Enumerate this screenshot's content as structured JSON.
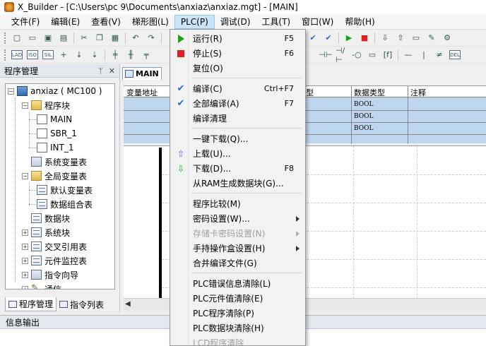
{
  "window": {
    "title": "X_Builder - [C:\\Users\\pc        9\\Documents\\anxiaz\\anxiaz.mgt] - [MAIN]"
  },
  "menubar": [
    {
      "label": "文件(F)"
    },
    {
      "label": "编辑(E)"
    },
    {
      "label": "查看(V)"
    },
    {
      "label": "梯形图(L)"
    },
    {
      "label": "PLC(P)"
    },
    {
      "label": "调试(D)"
    },
    {
      "label": "工具(T)"
    },
    {
      "label": "窗口(W)"
    },
    {
      "label": "帮助(H)"
    }
  ],
  "toolbar2": {
    "box_a": "LAD",
    "box_b": "ISO",
    "box_c": "SIL",
    "del": "DEL"
  },
  "left_panel": {
    "title": "程序管理",
    "pin": "ᛘ",
    "close": "✕",
    "tree": {
      "root": "anxiaz ( MC100 )",
      "program_block": "程序块",
      "main": "MAIN",
      "sbr": "SBR_1",
      "int": "INT_1",
      "system_var_table": "系统变量表",
      "global_var_table": "全局变量表",
      "default_var_table": "默认变量表",
      "data_group_table": "数据组合表",
      "data_block": "数据块",
      "system_block": "系统块",
      "cross_ref_table": "交叉引用表",
      "element_monitor_table": "元件监控表",
      "instruction_wizard": "指令向导",
      "communication": "通信"
    },
    "tabs": {
      "program_mgmt": "程序管理",
      "instruction_list": "指令列表"
    }
  },
  "editor": {
    "tab": "MAIN",
    "var_table": {
      "headers": {
        "var_addr": "变量地址",
        "type_partial": "型",
        "data_type": "数据类型",
        "comment": "注释"
      },
      "rows": [
        "BOOL",
        "BOOL",
        "BOOL"
      ]
    }
  },
  "output": {
    "title": "信息输出"
  },
  "watermark": {
    "text": "安下载",
    "url": "anxz.com"
  },
  "plc_menu": {
    "run": {
      "label": "运行(R)",
      "shortcut": "F5"
    },
    "stop": {
      "label": "停止(S)",
      "shortcut": "F6"
    },
    "reset": {
      "label": "复位(O)"
    },
    "compile": {
      "label": "编译(C)",
      "shortcut": "Ctrl+F7"
    },
    "compile_all": {
      "label": "全部编译(A)",
      "shortcut": "F7"
    },
    "compile_clean": {
      "label": "编译清理"
    },
    "one_key_download": {
      "label": "一键下载(Q)..."
    },
    "upload": {
      "label": "上载(U)..."
    },
    "download": {
      "label": "下载(D)...",
      "shortcut": "F8"
    },
    "ram_generate": {
      "label": "从RAM生成数据块(G)..."
    },
    "program_compare": {
      "label": "程序比较(M)"
    },
    "password_settings": {
      "label": "密码设置(W)..."
    },
    "card_password": {
      "label": "存储卡密码设置(N)"
    },
    "handheld_settings": {
      "label": "手持操作盒设置(H)"
    },
    "merge_compile": {
      "label": "合并编译文件(G)"
    },
    "clear_error": {
      "label": "PLC错误信息清除(L)"
    },
    "clear_element": {
      "label": "PLC元件值清除(E)"
    },
    "clear_program": {
      "label": "PLC程序清除(P)"
    },
    "clear_data_block": {
      "label": "PLC数据块清除(H)"
    },
    "lcd_clear": {
      "label": "LCD程序清除"
    }
  }
}
